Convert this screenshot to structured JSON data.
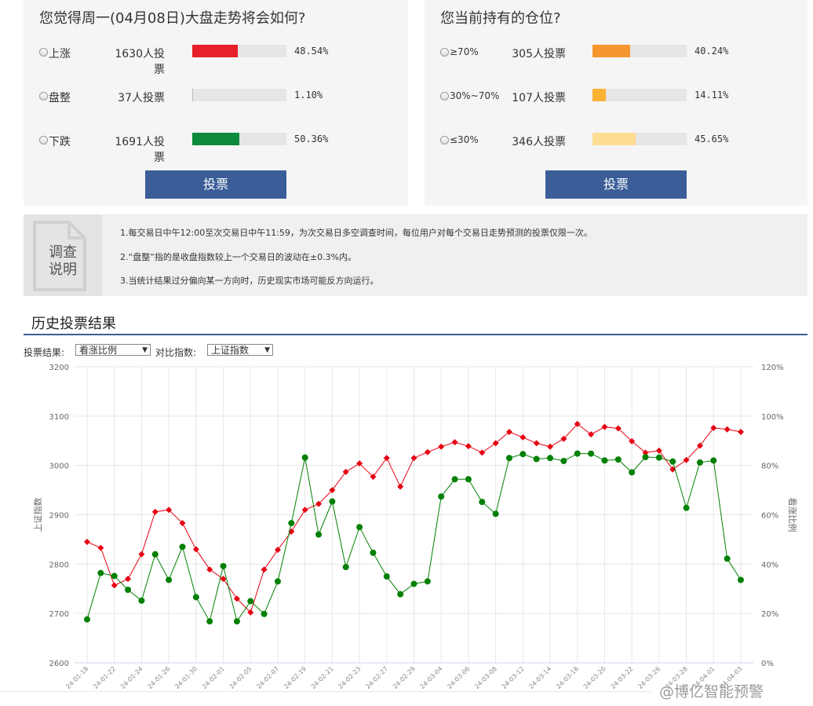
{
  "poll_market": {
    "title": "您觉得周一(04月08日)大盘走势将会如何?",
    "options": [
      {
        "label": "上涨",
        "votes": "1630人投票",
        "percent": "48.54%",
        "ratio": 0.4854,
        "color": "#e8202a"
      },
      {
        "label": "盘整",
        "votes": "37人投票",
        "percent": "1.10%",
        "ratio": 0.011,
        "color": "#bbbbbb"
      },
      {
        "label": "下跌",
        "votes": "1691人投票",
        "percent": "50.36%",
        "ratio": 0.5036,
        "color": "#0c8a3c"
      }
    ],
    "button": "投票"
  },
  "poll_position": {
    "title": "您当前持有的仓位?",
    "options": [
      {
        "label": "≥70%",
        "votes": "305人投票",
        "percent": "40.24%",
        "ratio": 0.4024,
        "color": "#f7962f"
      },
      {
        "label": "30%~70%",
        "votes": "107人投票",
        "percent": "14.11%",
        "ratio": 0.1411,
        "color": "#f9b233"
      },
      {
        "label": "≤30%",
        "votes": "346人投票",
        "percent": "45.65%",
        "ratio": 0.4565,
        "color": "#fddc94"
      }
    ],
    "button": "投票"
  },
  "notes": {
    "label_line1": "调查",
    "label_line2": "说明",
    "lines": [
      "1.每交易日中午12:00至次交易日中午11:59，为次交易日多空调查时间，每位用户对每个交易日走势预测的投票仅限一次。",
      "2.“盘整”指的是收盘指数较上一个交易日的波动在±0.3%内。",
      "3.当统计结果过分偏向某一方向时，历史现实市场可能反方向运行。"
    ]
  },
  "history": {
    "title": "历史投票结果",
    "vote_result_label": "投票结果:",
    "vote_result_value": "看涨比例",
    "compare_label": "对比指数:",
    "compare_value": "上证指数"
  },
  "watermark": "@博亿智能预警",
  "chart_data": {
    "type": "line",
    "ylabel": "上证指数",
    "y2label": "看涨比例",
    "ylim": [
      2600,
      3200
    ],
    "y2lim": [
      0,
      120
    ],
    "yticks": [
      2600,
      2700,
      2800,
      2900,
      3000,
      3100,
      3200
    ],
    "y2ticks": [
      "0%",
      "20%",
      "40%",
      "60%",
      "80%",
      "100%",
      "120%"
    ],
    "xtick_labels": [
      "24-01-18",
      "24-01-22",
      "24-01-24",
      "24-01-26",
      "24-01-30",
      "24-02-01",
      "24-02-05",
      "24-02-07",
      "24-02-19",
      "24-02-21",
      "24-02-23",
      "24-02-27",
      "24-02-29",
      "24-03-04",
      "24-03-06",
      "24-03-08",
      "24-03-12",
      "24-03-14",
      "24-03-18",
      "24-03-20",
      "24-03-22",
      "24-03-26",
      "24-03-28",
      "24-04-01",
      "24-04-03"
    ],
    "series": [
      {
        "name": "上证指数",
        "axis": "left",
        "color": "#e60012",
        "marker": "diamond",
        "values": [
          2845,
          2833,
          2757,
          2770,
          2820,
          2906,
          2910,
          2883,
          2830,
          2789,
          2770,
          2730,
          2702,
          2789,
          2829,
          2866,
          2910,
          2922,
          2950,
          2987,
          3004,
          2977,
          3015,
          2957,
          3015,
          3027,
          3038,
          3047,
          3039,
          3026,
          3045,
          3068,
          3057,
          3045,
          3038,
          3054,
          3084,
          3063,
          3078,
          3075,
          3049,
          3026,
          3030,
          2992,
          3011,
          3040,
          3076,
          3073,
          3068
        ]
      },
      {
        "name": "看涨比例",
        "axis": "right",
        "color": "#008000",
        "marker": "circle",
        "values": [
          17.6,
          36.4,
          35.2,
          29.6,
          25.2,
          44,
          33.6,
          47,
          26.6,
          16.8,
          39.2,
          16.8,
          25,
          19.8,
          33,
          56.6,
          83.2,
          52,
          65.4,
          38.8,
          55,
          44.6,
          35,
          27.8,
          32,
          33,
          67.4,
          74.4,
          74.4,
          65.2,
          60.4,
          83,
          84.6,
          82.6,
          83,
          81.8,
          84.8,
          84.8,
          82,
          82.4,
          77.2,
          83.4,
          83.2,
          81.6,
          62.8,
          81.2,
          82,
          42.2,
          33.6
        ]
      }
    ]
  }
}
